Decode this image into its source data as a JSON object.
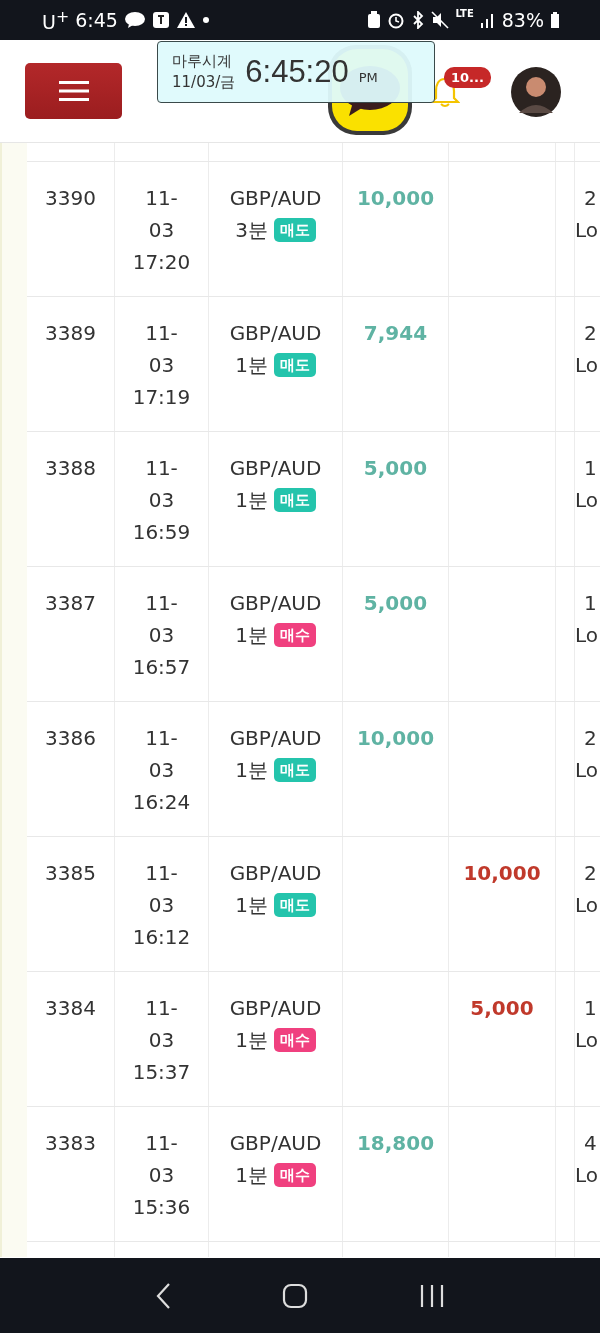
{
  "status_bar": {
    "carrier": "U$^{+}$",
    "time": "6:45",
    "network": "LTE",
    "battery": "83%"
  },
  "header": {
    "notification_badge": "10..."
  },
  "clock_widget": {
    "name": "마루시계",
    "date": "11/03/금",
    "time": "6:45:20",
    "ampm": "PM"
  },
  "trades": [
    {
      "no": "3390",
      "datetime": [
        "11-",
        "03",
        "17:20"
      ],
      "symbol": "GBP/AUD",
      "period": "3분",
      "side": {
        "kind": "sell",
        "label": "매도"
      },
      "profit": "10,000",
      "lot": [
        "2",
        "Lo"
      ]
    },
    {
      "no": "3389",
      "datetime": [
        "11-",
        "03",
        "17:19"
      ],
      "symbol": "GBP/AUD",
      "period": "1분",
      "side": {
        "kind": "sell",
        "label": "매도"
      },
      "profit": "7,944",
      "lot": [
        "2",
        "Lo"
      ]
    },
    {
      "no": "3388",
      "datetime": [
        "11-",
        "03",
        "16:59"
      ],
      "symbol": "GBP/AUD",
      "period": "1분",
      "side": {
        "kind": "sell",
        "label": "매도"
      },
      "profit": "5,000",
      "lot": [
        "1",
        "Lo"
      ]
    },
    {
      "no": "3387",
      "datetime": [
        "11-",
        "03",
        "16:57"
      ],
      "symbol": "GBP/AUD",
      "period": "1분",
      "side": {
        "kind": "buy",
        "label": "매수"
      },
      "profit": "5,000",
      "lot": [
        "1",
        "Lo"
      ]
    },
    {
      "no": "3386",
      "datetime": [
        "11-",
        "03",
        "16:24"
      ],
      "symbol": "GBP/AUD",
      "period": "1분",
      "side": {
        "kind": "sell",
        "label": "매도"
      },
      "profit": "10,000",
      "lot": [
        "2",
        "Lo"
      ]
    },
    {
      "no": "3385",
      "datetime": [
        "11-",
        "03",
        "16:12"
      ],
      "symbol": "GBP/AUD",
      "period": "1분",
      "side": {
        "kind": "sell",
        "label": "매도"
      },
      "loss": "10,000",
      "lot": [
        "2",
        "Lo"
      ]
    },
    {
      "no": "3384",
      "datetime": [
        "11-",
        "03",
        "15:37"
      ],
      "symbol": "GBP/AUD",
      "period": "1분",
      "side": {
        "kind": "buy",
        "label": "매수"
      },
      "loss": "5,000",
      "lot": [
        "1",
        "Lo"
      ]
    },
    {
      "no": "3383",
      "datetime": [
        "11-",
        "03",
        "15:36"
      ],
      "symbol": "GBP/AUD",
      "period": "1분",
      "side": {
        "kind": "buy",
        "label": "매수"
      },
      "profit": "18,800",
      "lot": [
        "4",
        "Lo"
      ]
    }
  ]
}
